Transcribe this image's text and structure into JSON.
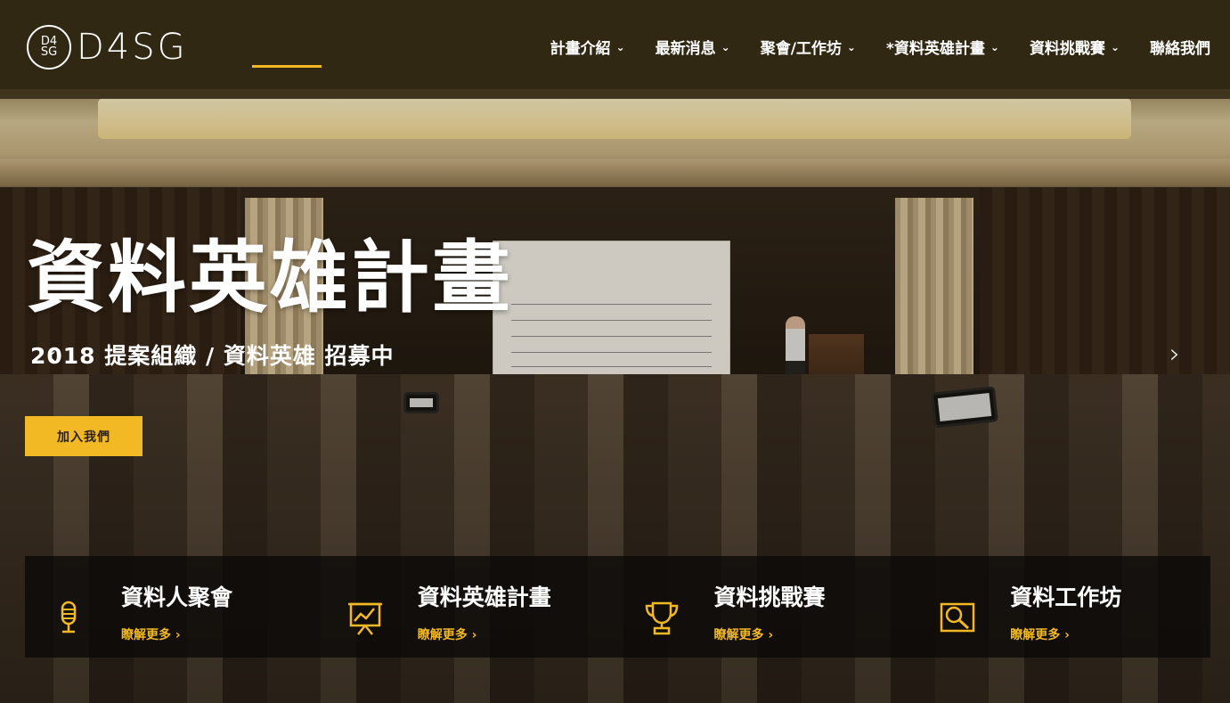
{
  "header": {
    "logo_mark": "D4\nSG",
    "logo_text": "D4SG",
    "nav": [
      {
        "label": "計畫介紹",
        "has_dropdown": true
      },
      {
        "label": "最新消息",
        "has_dropdown": true
      },
      {
        "label": "聚會/工作坊",
        "has_dropdown": true
      },
      {
        "label": "*資料英雄計畫",
        "has_dropdown": true
      },
      {
        "label": "資料挑戰賽",
        "has_dropdown": true
      },
      {
        "label": "聯絡我們",
        "has_dropdown": false
      }
    ]
  },
  "hero": {
    "title": "資料英雄計畫",
    "subtitle": "2018 提案組織 / 資料英雄 招募中",
    "cta_label": "加入我們",
    "prev_icon": "chevron-left-icon",
    "next_icon": "chevron-right-icon"
  },
  "features": [
    {
      "title": "資料人聚會",
      "link": "瞭解更多 ›",
      "icon": "microphone-icon"
    },
    {
      "title": "資料英雄計畫",
      "link": "瞭解更多 ›",
      "icon": "presentation-chart-icon"
    },
    {
      "title": "資料挑戰賽",
      "link": "瞭解更多 ›",
      "icon": "trophy-icon"
    },
    {
      "title": "資料工作坊",
      "link": "瞭解更多 ›",
      "icon": "magnifier-icon"
    }
  ],
  "colors": {
    "accent": "#f2b925",
    "header_bg": "#332a14",
    "feature_bar_bg": "#0c0a08"
  }
}
